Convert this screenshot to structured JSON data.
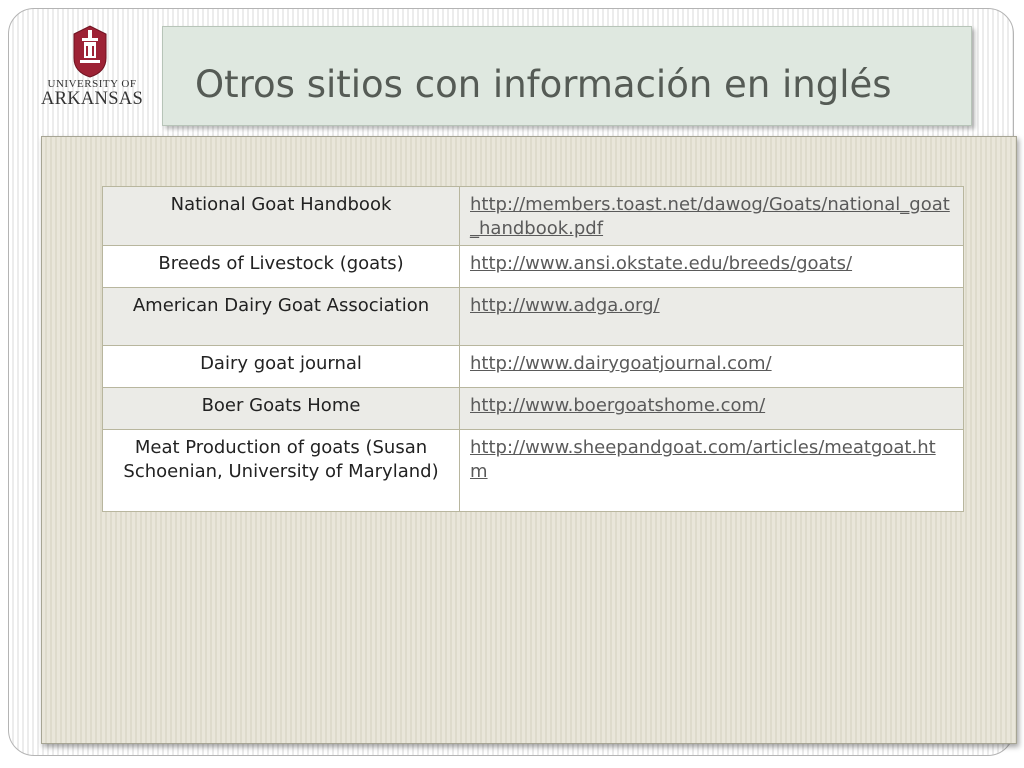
{
  "logo": {
    "line1": "UNIVERSITY OF",
    "line2": "ARKANSAS",
    "brand_color": "#9d2235"
  },
  "title": "Otros sitios con información en inglés",
  "rows": [
    {
      "name": "National Goat Handbook",
      "url": "http://members.toast.net/dawog/Goats/national_goat_handbook.pdf"
    },
    {
      "name": "Breeds of Livestock (goats)",
      "url": "http://www.ansi.okstate.edu/breeds/goats/"
    },
    {
      "name": "American Dairy Goat Association",
      "url": "http://www.adga.org/"
    },
    {
      "name": "Dairy goat journal",
      "url": "http://www.dairygoatjournal.com/"
    },
    {
      "name": "Boer Goats Home",
      "url": "http://www.boergoatshome.com/"
    },
    {
      "name": "Meat Production of goats (Susan Schoenian, University of Maryland)",
      "url": "http://www.sheepandgoat.com/articles/meatgoat.htm"
    }
  ]
}
